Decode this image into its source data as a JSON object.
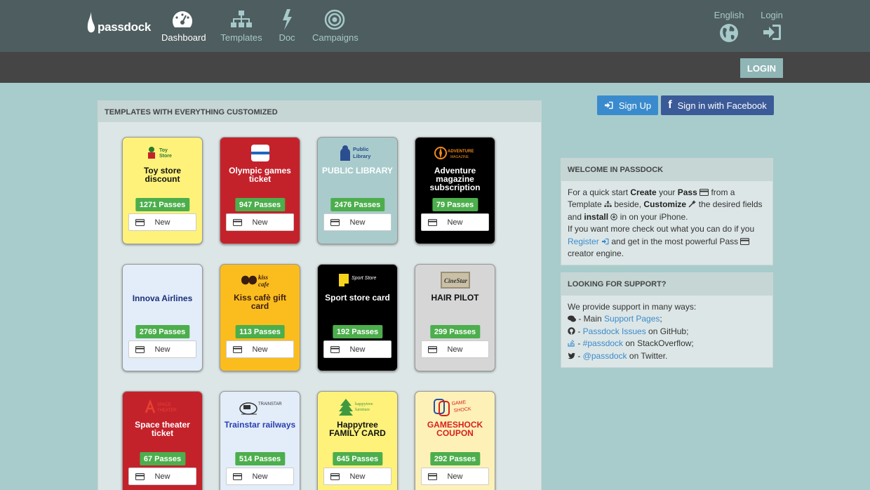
{
  "app": {
    "logo_text": "passdock"
  },
  "nav": {
    "items": [
      {
        "label": "Dashboard",
        "icon": "dashboard-icon"
      },
      {
        "label": "Templates",
        "icon": "sitemap-icon"
      },
      {
        "label": "Doc",
        "icon": "bolt-icon"
      },
      {
        "label": "Campaigns",
        "icon": "target-icon"
      }
    ],
    "language": {
      "label": "English",
      "icon": "globe-icon"
    },
    "login": {
      "label": "Login",
      "icon": "sign-in-icon"
    }
  },
  "subbar": {
    "login_button": "LOGIN"
  },
  "templates": {
    "heading": "TEMPLATES WITH EVERYTHING CUSTOMIZED",
    "new_label": "New",
    "cards": [
      {
        "title": "Toy store discount",
        "passes": "1271 Passes",
        "logo_text": "Toy Store",
        "bg": "#fef27a",
        "fg": "#111111"
      },
      {
        "title": "Olympic games ticket",
        "passes": "947 Passes",
        "logo_text": "",
        "bg": "#c4222b",
        "fg": "#ffffff"
      },
      {
        "title": "PUBLIC LIBRARY",
        "passes": "2476 Passes",
        "logo_text": "Public Library",
        "bg": "#a9cbcc",
        "fg": "#ffffff"
      },
      {
        "title": "Adventure magazine subscription",
        "passes": "79 Passes",
        "logo_text": "ADVENTURE MAGAZINE",
        "bg": "#000000",
        "fg": "#ffffff"
      },
      {
        "title": "Innova Airlines",
        "passes": "2769 Passes",
        "logo_text": "",
        "bg": "#e2edf9",
        "fg": "#1b2f7a"
      },
      {
        "title": "Kiss cafè gift card",
        "passes": "113 Passes",
        "logo_text": "kiss cafe'",
        "bg": "#fbbd1e",
        "fg": "#3a1d10"
      },
      {
        "title": "Sport store card",
        "passes": "192 Passes",
        "logo_text": "Sport Store",
        "bg": "#000000",
        "fg": "#ffffff"
      },
      {
        "title": "HAIR PILOT",
        "passes": "299 Passes",
        "logo_text": "CineStar",
        "bg": "#d6d6d6",
        "fg": "#111111"
      },
      {
        "title": "Space theater ticket",
        "passes": "67 Passes",
        "logo_text": "SPACE THEATER",
        "bg": "#c4222b",
        "fg": "#ffffff"
      },
      {
        "title": "Trainstar railways",
        "passes": "514 Passes",
        "logo_text": "TRAINSTAR",
        "bg": "#e2edf9",
        "fg": "#2a3fb3"
      },
      {
        "title": "Happytree FAMILY CARD",
        "passes": "645 Passes",
        "logo_text": "happytree furniture",
        "bg": "#fef27a",
        "fg": "#111111"
      },
      {
        "title": "GAMESHOCK COUPON",
        "passes": "292 Passes",
        "logo_text": "GAME SHOCK",
        "bg": "#fef1b8",
        "fg": "#d8201d"
      }
    ]
  },
  "signup": {
    "label": "Sign Up"
  },
  "facebook": {
    "label": "Sign in with Facebook"
  },
  "welcome": {
    "heading": "WELCOME IN PASSDOCK",
    "t1": "For a quick start ",
    "b1": "Create",
    "t2": " your ",
    "b2": "Pass",
    "t3": " from a Template ",
    "t4": " beside, ",
    "b3": "Customize",
    "t5": " the desired fields and ",
    "b4": "install",
    "t6": " in on your iPhone.",
    "t7": "If you want more check out what you can do if you ",
    "register": "Register",
    "t8": " and get in the most powerful Pass ",
    "t9": " creator engine."
  },
  "support": {
    "heading": "LOOKING FOR SUPPORT?",
    "intro": "We provide support in many ways:",
    "l1_pre": " - Main ",
    "l1_link": "Support Pages",
    "l1_post": ";",
    "l2_pre": " - ",
    "l2_link": "Passdock Issues",
    "l2_post": " on GitHub;",
    "l3_pre": " - ",
    "l3_link": "#passdock",
    "l3_post": " on StackOverflow;",
    "l4_pre": " - ",
    "l4_link": "@passdock",
    "l4_post": " on Twitter."
  }
}
